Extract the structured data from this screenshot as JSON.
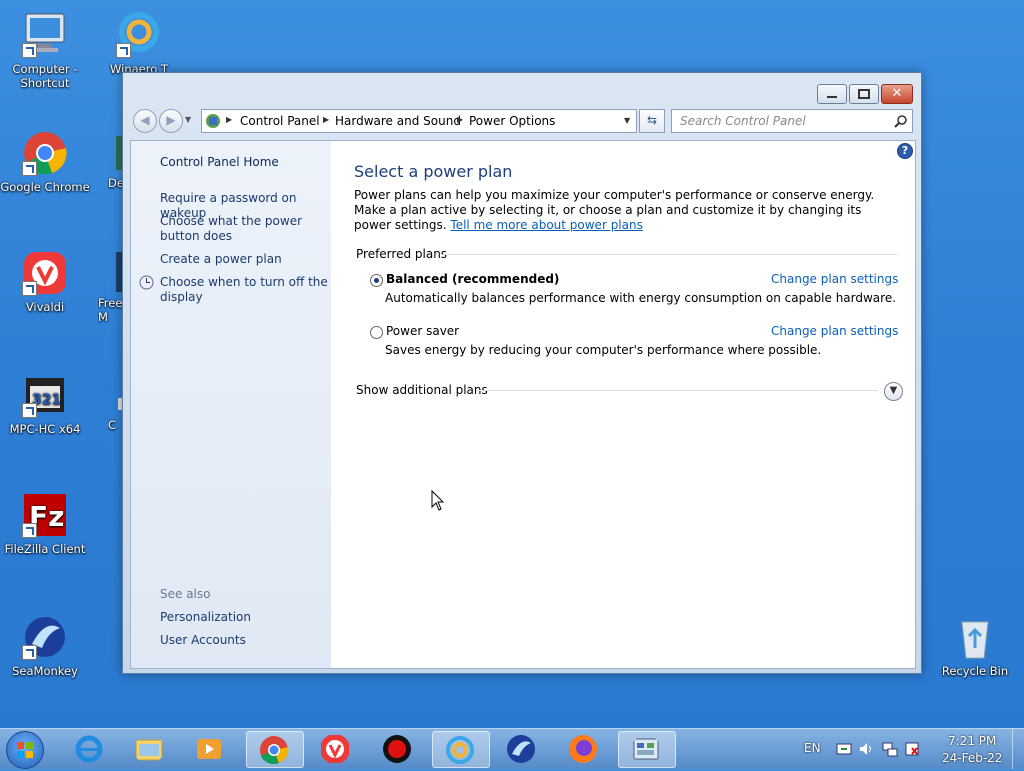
{
  "desktop": {
    "icons": [
      {
        "label": "Computer - Shortcut"
      },
      {
        "label": "Winaero T"
      },
      {
        "label": "Google Chrome"
      },
      {
        "label": "De"
      },
      {
        "label": "Vivaldi"
      },
      {
        "label": "Free M"
      },
      {
        "label": "MPC-HC x64"
      },
      {
        "label": "C"
      },
      {
        "label": "FileZilla Client"
      },
      {
        "label": "SeaMonkey"
      },
      {
        "label": "Recycle Bin"
      }
    ]
  },
  "window": {
    "address": {
      "crumbs": [
        "Control Panel",
        "Hardware and Sound",
        "Power Options"
      ]
    },
    "search": {
      "placeholder": "Search Control Panel"
    },
    "sidebar": {
      "home": "Control Panel Home",
      "links": [
        "Require a password on wakeup",
        "Choose what the power button does",
        "Create a power plan",
        "Choose when to turn off the display"
      ],
      "see_also_label": "See also",
      "see_also": [
        "Personalization",
        "User Accounts"
      ]
    },
    "main": {
      "title": "Select a power plan",
      "description": "Power plans can help you maximize your computer's performance or conserve energy. Make a plan active by selecting it, or choose a plan and customize it by changing its power settings.",
      "description_link": "Tell me more about power plans",
      "preferred_label": "Preferred plans",
      "plans": [
        {
          "name": "Balanced (recommended)",
          "selected": true,
          "desc": "Automatically balances performance with energy consumption on capable hardware.",
          "action": "Change plan settings"
        },
        {
          "name": "Power saver",
          "selected": false,
          "desc": "Saves energy by reducing your computer's performance where possible.",
          "action": "Change plan settings"
        }
      ],
      "additional_label": "Show additional plans"
    }
  },
  "taskbar": {
    "language": "EN",
    "time": "7:21 PM",
    "date": "24-Feb-22"
  }
}
